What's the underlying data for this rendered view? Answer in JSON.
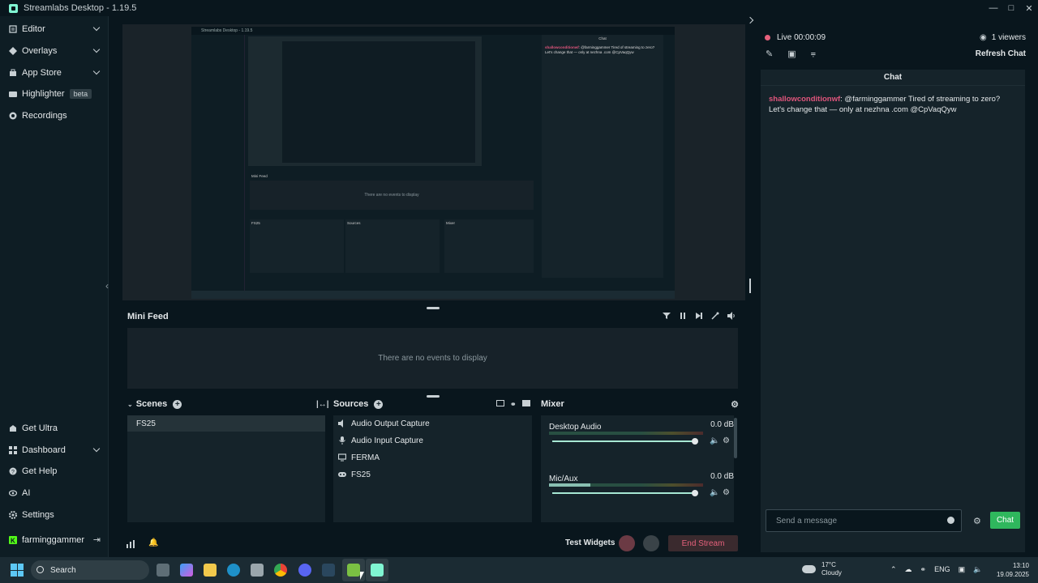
{
  "window": {
    "title": "Streamlabs Desktop - 1.19.5"
  },
  "sidebar": {
    "top_items": [
      {
        "label": "Editor",
        "icon": "editor-icon",
        "has_chevron": true
      },
      {
        "label": "Overlays",
        "icon": "overlays-icon",
        "has_chevron": true
      },
      {
        "label": "App Store",
        "icon": "app-store-icon",
        "has_chevron": true
      },
      {
        "label": "Highlighter",
        "icon": "highlighter-icon",
        "badge": "beta"
      },
      {
        "label": "Recordings",
        "icon": "recordings-icon"
      }
    ],
    "bottom_items": [
      {
        "label": "Get Ultra",
        "icon": "ultra-icon"
      },
      {
        "label": "Dashboard",
        "icon": "dashboard-icon",
        "has_chevron": true
      },
      {
        "label": "Get Help",
        "icon": "help-icon"
      },
      {
        "label": "AI",
        "icon": "ai-icon"
      },
      {
        "label": "Settings",
        "icon": "settings-icon"
      }
    ],
    "account": {
      "label": "farminggammer",
      "icon": "kick-logo-icon"
    }
  },
  "preview": {
    "title": "Streamlabs Desktop - 1.19.5",
    "chat_title": "Chat",
    "empty_text": "There are no events to display",
    "mini_feed": "Mini Feed",
    "scenes": "Scenes",
    "scene": "FS25",
    "sources": "Sources",
    "mixer": "Mixer",
    "live": "Live 00:00:09",
    "end_stream": "End Stream"
  },
  "mini_feed": {
    "title": "Mini Feed",
    "empty": "There are no events to display"
  },
  "scenes": {
    "title": "Scenes",
    "items": [
      "FS25"
    ]
  },
  "sources": {
    "title": "Sources",
    "items": [
      {
        "label": "Audio Output Capture",
        "icon": "speaker-icon"
      },
      {
        "label": "Audio Input Capture",
        "icon": "mic-icon"
      },
      {
        "label": "FERMA",
        "icon": "monitor-icon"
      },
      {
        "label": "FS25",
        "icon": "gamepad-icon"
      }
    ]
  },
  "mixer": {
    "title": "Mixer",
    "channels": [
      {
        "label": "Desktop Audio",
        "db": "0.0 dB",
        "level": 0.0,
        "volume": 1.0
      },
      {
        "label": "Mic/Aux",
        "db": "0.0 dB",
        "level": 0.27,
        "volume": 1.0
      }
    ]
  },
  "bottom_bar": {
    "test_widgets": "Test Widgets",
    "end_stream": "End Stream"
  },
  "chat": {
    "live_label": "Live 00:00:09",
    "viewers": "1 viewers",
    "refresh": "Refresh Chat",
    "header": "Chat",
    "messages": [
      {
        "user": "shallowconditionwf",
        "text": ": @farminggammer Tired of streaming to zero? Let's change that — only at nezhna .com @CpVaqQyw"
      }
    ],
    "input_placeholder": "Send a message",
    "send": "Chat"
  },
  "taskbar": {
    "search": "Search",
    "weather_temp": "17°C",
    "weather_desc": "Cloudy",
    "lang": "ENG",
    "time": "13:10",
    "date": "19.09.2025"
  },
  "colors": {
    "accent": "#80f5d2",
    "live": "#e6617c",
    "chat_button": "#2fb75d",
    "username": "#e0557c"
  }
}
